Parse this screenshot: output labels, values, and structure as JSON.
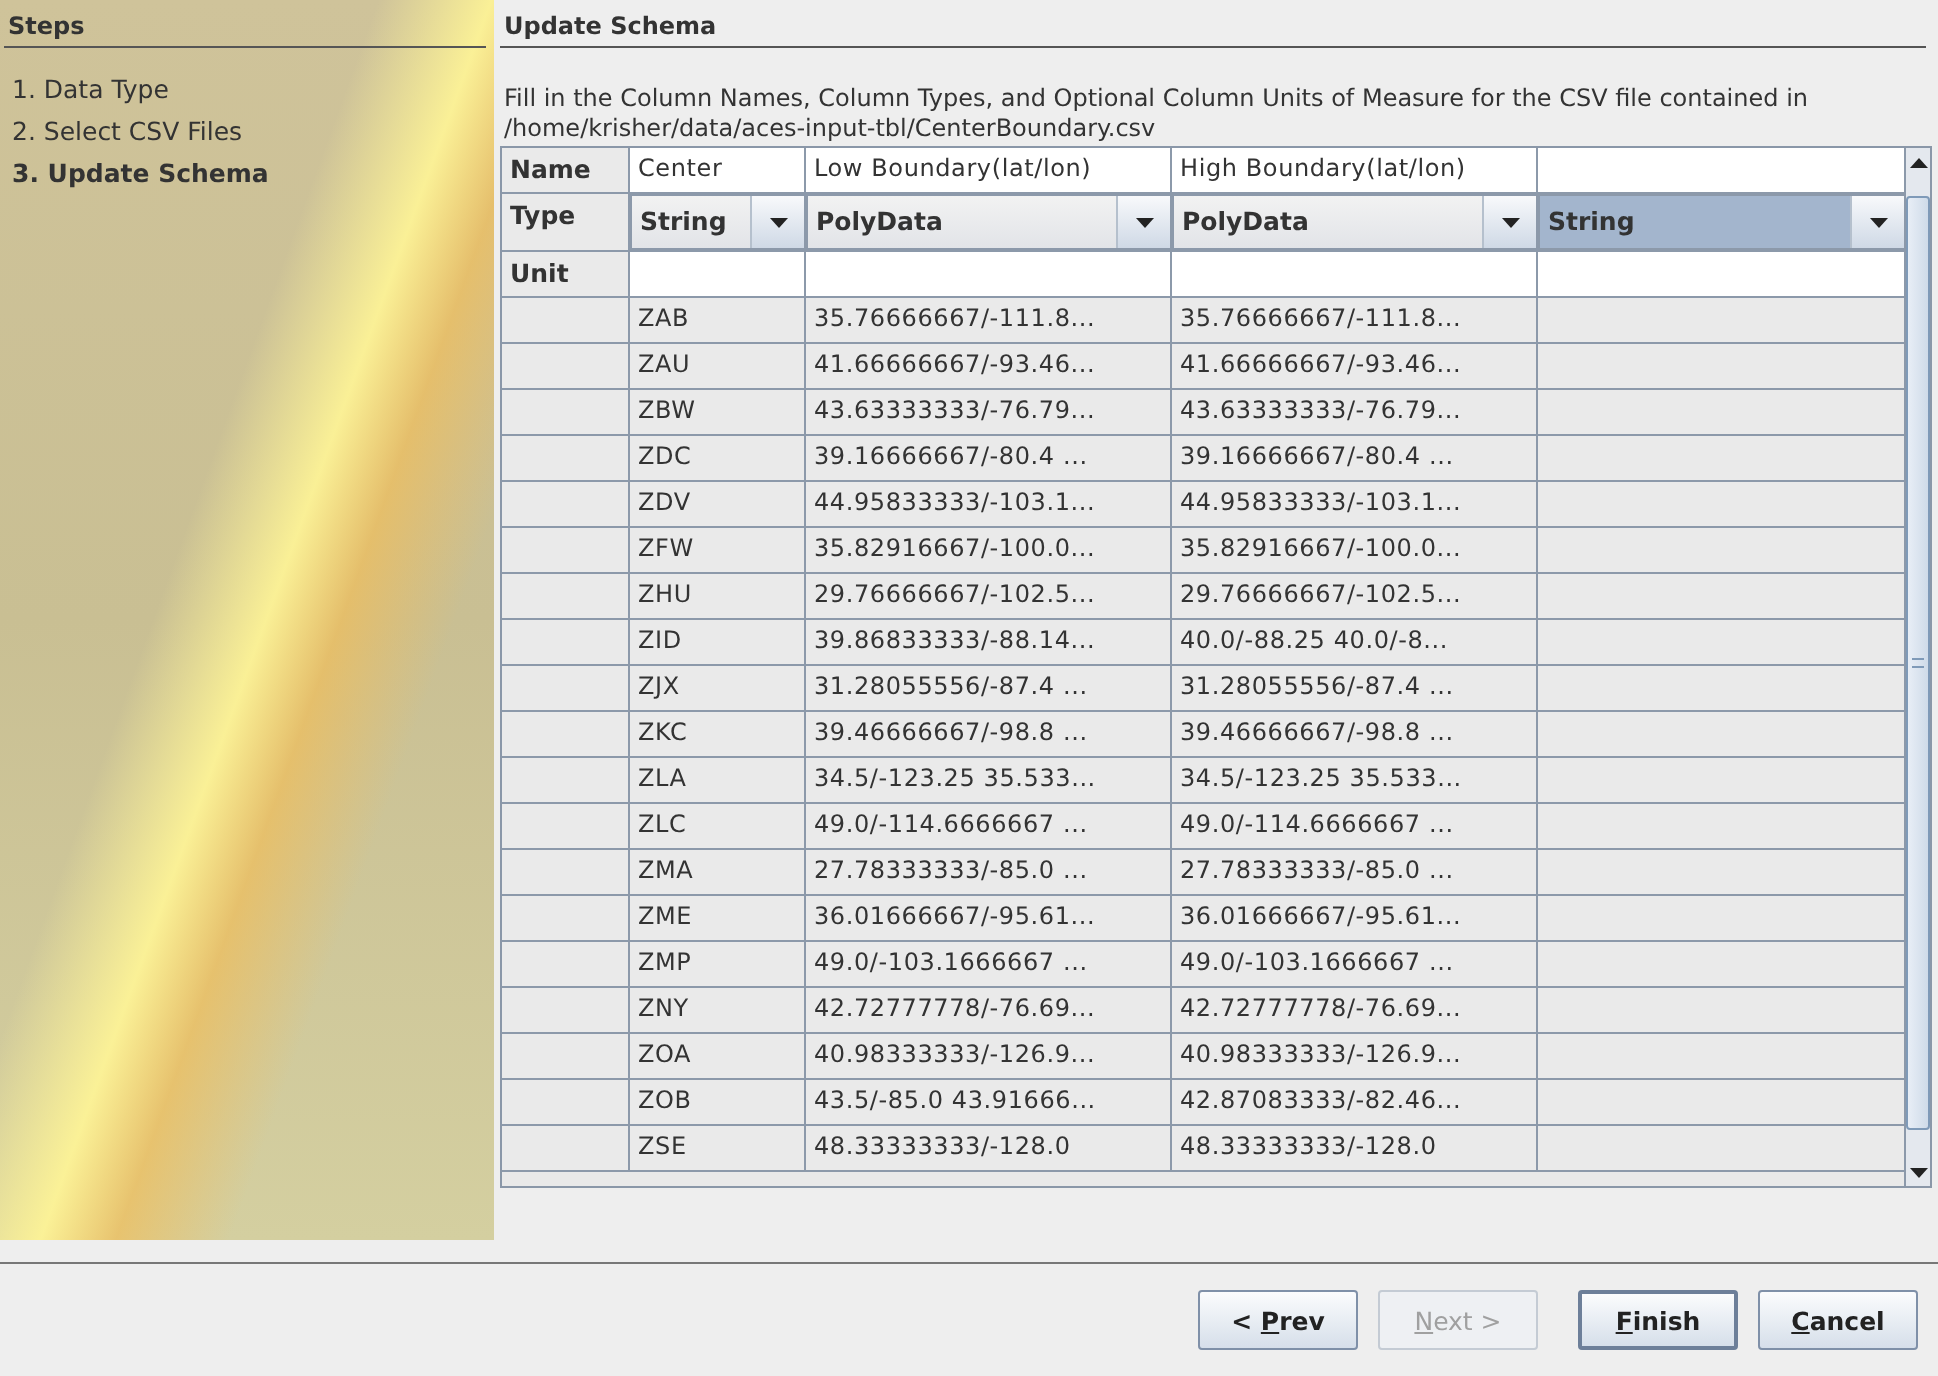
{
  "steps": {
    "title": "Steps",
    "items": [
      {
        "label": "1. Data Type",
        "selected": false
      },
      {
        "label": "2. Select CSV Files",
        "selected": false
      },
      {
        "label": "3. Update Schema",
        "selected": true
      }
    ]
  },
  "panel": {
    "title": "Update Schema",
    "description": "Fill in the Column Names, Column Types, and Optional Column Units of Measure for the CSV file contained in /home/krisher/data/aces-input-tbl/CenterBoundary.csv"
  },
  "schema": {
    "row_labels": {
      "name": "Name",
      "type": "Type",
      "unit": "Unit"
    },
    "columns": [
      {
        "name": "Center",
        "type": "String",
        "selected": false
      },
      {
        "name": "Low Boundary(lat/lon)",
        "type": "PolyData",
        "selected": false
      },
      {
        "name": "High Boundary(lat/lon)",
        "type": "PolyData",
        "selected": false
      },
      {
        "type": "String",
        "selected": true
      }
    ],
    "rows": [
      [
        "ZAB",
        "35.76666667/-111.8...",
        "35.76666667/-111.8..."
      ],
      [
        "ZAU",
        "41.66666667/-93.46...",
        "41.66666667/-93.46..."
      ],
      [
        "ZBW",
        "43.63333333/-76.79...",
        "43.63333333/-76.79..."
      ],
      [
        "ZDC",
        "39.16666667/-80.4 ...",
        "39.16666667/-80.4 ..."
      ],
      [
        "ZDV",
        "44.95833333/-103.1...",
        "44.95833333/-103.1..."
      ],
      [
        "ZFW",
        "35.82916667/-100.0...",
        "35.82916667/-100.0..."
      ],
      [
        "ZHU",
        "29.76666667/-102.5...",
        "29.76666667/-102.5..."
      ],
      [
        "ZID",
        "39.86833333/-88.14...",
        "40.0/-88.25 40.0/-8..."
      ],
      [
        "ZJX",
        "31.28055556/-87.4 ...",
        "31.28055556/-87.4 ..."
      ],
      [
        "ZKC",
        "39.46666667/-98.8 ...",
        "39.46666667/-98.8 ..."
      ],
      [
        "ZLA",
        "34.5/-123.25 35.533...",
        "34.5/-123.25 35.533..."
      ],
      [
        "ZLC",
        "49.0/-114.6666667 ...",
        "49.0/-114.6666667 ..."
      ],
      [
        "ZMA",
        "27.78333333/-85.0 ...",
        "27.78333333/-85.0 ..."
      ],
      [
        "ZME",
        "36.01666667/-95.61...",
        "36.01666667/-95.61..."
      ],
      [
        "ZMP",
        "49.0/-103.1666667 ...",
        "49.0/-103.1666667 ..."
      ],
      [
        "ZNY",
        "42.72777778/-76.69...",
        "42.72777778/-76.69..."
      ],
      [
        "ZOA",
        "40.98333333/-126.9...",
        "40.98333333/-126.9..."
      ],
      [
        "ZOB",
        "43.5/-85.0 43.91666...",
        "42.87083333/-82.46..."
      ],
      [
        "ZSE",
        "48.33333333/-128.0",
        "48.33333333/-128.0"
      ]
    ]
  },
  "buttons": [
    {
      "label": "< Prev",
      "disabled": false
    },
    {
      "label": "Next >",
      "disabled": true
    },
    {
      "label": "Finish",
      "disabled": false
    },
    {
      "label": "Cancel",
      "disabled": false
    }
  ]
}
